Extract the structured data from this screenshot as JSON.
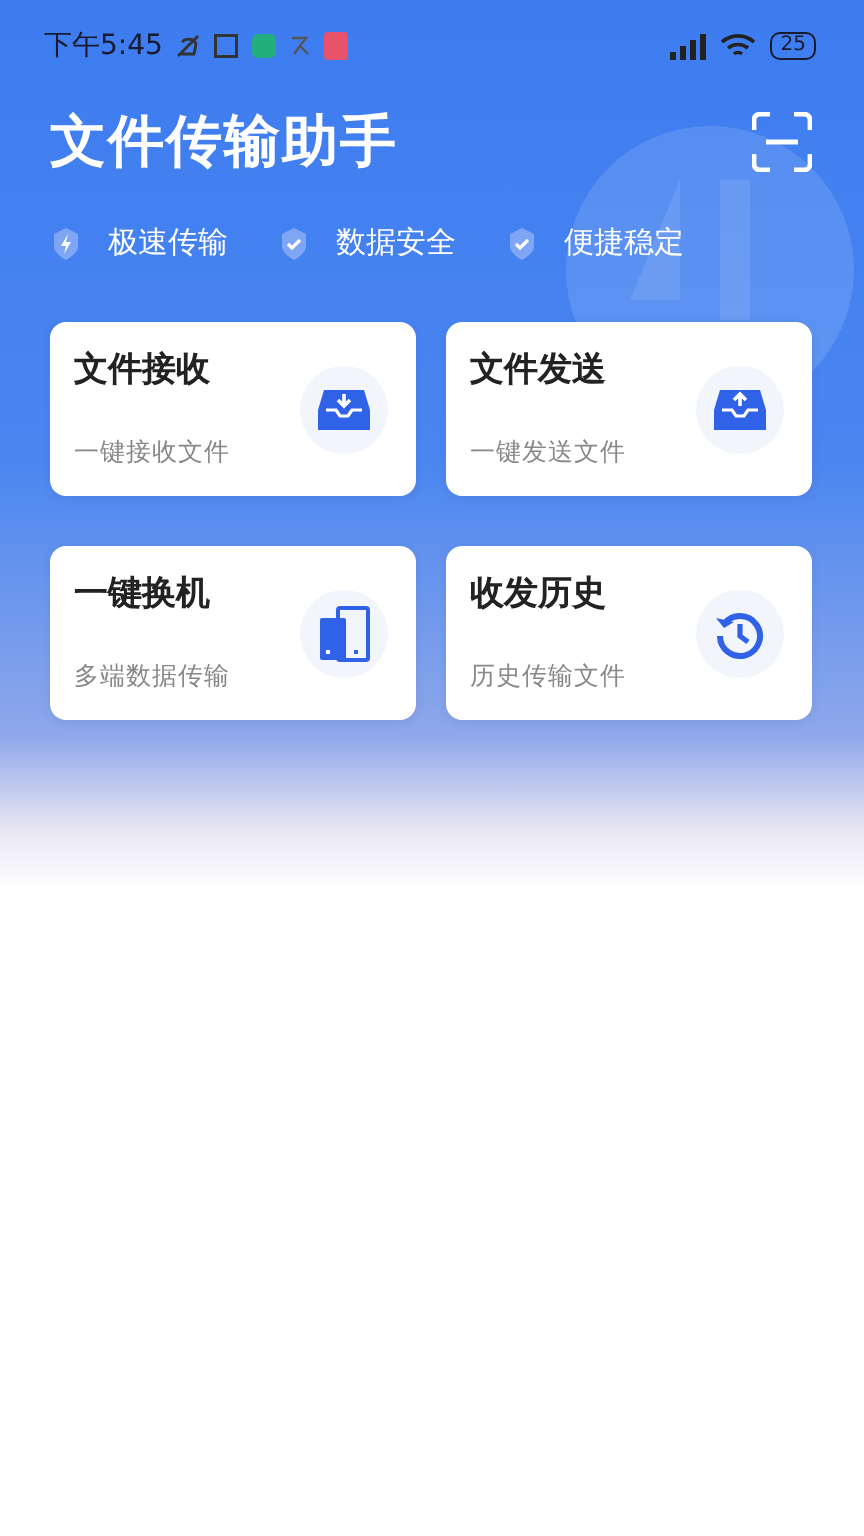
{
  "status_bar": {
    "time": "下午5:45",
    "battery": "25"
  },
  "header": {
    "title": "文件传输助手"
  },
  "features": [
    {
      "kind": "bolt",
      "label": "极速传输"
    },
    {
      "kind": "check",
      "label": "数据安全"
    },
    {
      "kind": "check",
      "label": "便捷稳定"
    }
  ],
  "cards": [
    {
      "kind": "receive",
      "title": "文件接收",
      "subtitle": "一键接收文件"
    },
    {
      "kind": "send",
      "title": "文件发送",
      "subtitle": "一键发送文件"
    },
    {
      "kind": "switch",
      "title": "一键换机",
      "subtitle": "多端数据传输"
    },
    {
      "kind": "history",
      "title": "收发历史",
      "subtitle": "历史传输文件"
    }
  ]
}
